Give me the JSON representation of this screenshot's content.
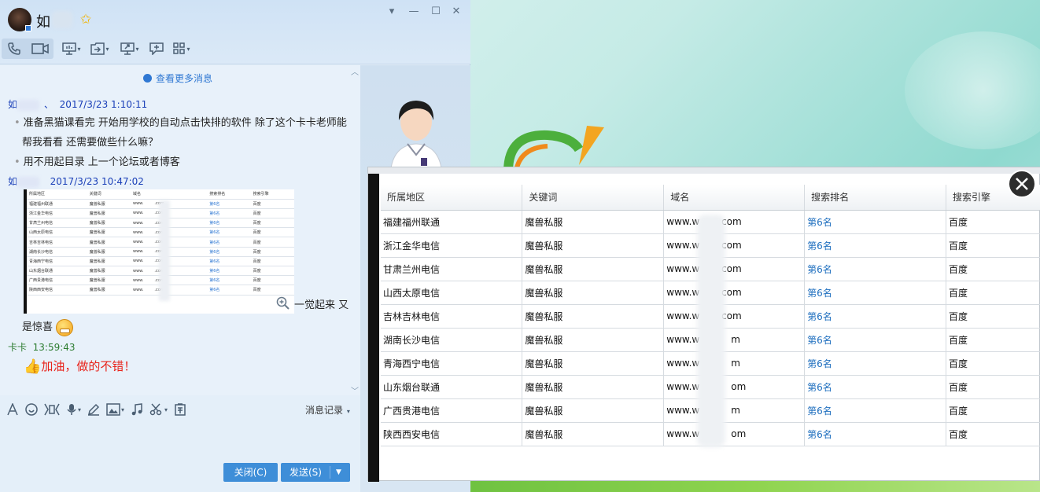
{
  "chat": {
    "contact_name": "如",
    "header": {
      "window_controls": [
        "▾",
        "—",
        "☐",
        "✕"
      ]
    },
    "see_more": "查看更多消息",
    "messages": [
      {
        "sender": "如",
        "sep": "、",
        "time": "2017/3/23 1:10:11"
      },
      {
        "line1": "准备黑猫课看完 开始用学校的自动点击快排的软件 除了这个卡卡老师能",
        "line2": "帮我看看 还需要做些什么嘛？",
        "line3": "用不用起目录 上一个论坛或者博客"
      },
      {
        "sender": "如",
        "time": "2017/3/23 10:47:02",
        "after_image": "一觉起来 又",
        "after_image2": "是惊喜"
      },
      {
        "sender": "卡卡",
        "time": "13:59:43",
        "text": "加油，做的不错！"
      }
    ],
    "history_label": "消息记录",
    "close_label": "关闭(C)",
    "send_label": "发送(S)"
  },
  "thumb_table": {
    "headers": [
      "所属地区",
      "关键词",
      "域名",
      "搜索排名",
      "搜索引擎"
    ],
    "rows": [
      [
        "福建福州联通",
        "魔兽私服",
        "www.",
        ".com",
        "第6名",
        "百度"
      ],
      [
        "浙江金华电信",
        "魔兽私服",
        "www.",
        ".com",
        "第6名",
        "百度"
      ],
      [
        "甘肃兰州电信",
        "魔兽私服",
        "www.",
        ".com",
        "第6名",
        "百度"
      ],
      [
        "山西太原电信",
        "魔兽私服",
        "www.",
        ".com",
        "第6名",
        "百度"
      ],
      [
        "吉林吉林电信",
        "魔兽私服",
        "www.",
        ".com",
        "第6名",
        "百度"
      ],
      [
        "湖南长沙电信",
        "魔兽私服",
        "www.",
        ".com",
        "第6名",
        "百度"
      ],
      [
        "青海西宁电信",
        "魔兽私服",
        "www.",
        ".com",
        "第6名",
        "百度"
      ],
      [
        "山东烟台联通",
        "魔兽私服",
        "www.",
        ".com",
        "第6名",
        "百度"
      ],
      [
        "广西贵港电信",
        "魔兽私服",
        "www.",
        ".com",
        "第6名",
        "百度"
      ],
      [
        "陕西西安电信",
        "魔兽私服",
        "www.",
        ".com",
        "第6名",
        "百度"
      ]
    ]
  },
  "table": {
    "headers": [
      "所属地区",
      "关键词",
      "域名",
      "搜索排名",
      "搜索引擎"
    ],
    "rows": [
      {
        "region": "福建福州联通",
        "keyword": "魔兽私服",
        "domain": "www.w",
        "domain_end": ".com",
        "rank": "第6名",
        "engine": "百度"
      },
      {
        "region": "浙江金华电信",
        "keyword": "魔兽私服",
        "domain": "www.w",
        "domain_end": ".com",
        "rank": "第6名",
        "engine": "百度"
      },
      {
        "region": "甘肃兰州电信",
        "keyword": "魔兽私服",
        "domain": "www.w",
        "domain_end": ".com",
        "rank": "第6名",
        "engine": "百度"
      },
      {
        "region": "山西太原电信",
        "keyword": "魔兽私服",
        "domain": "www.w",
        "domain_end": ".com",
        "rank": "第6名",
        "engine": "百度"
      },
      {
        "region": "吉林吉林电信",
        "keyword": "魔兽私服",
        "domain": "www.w",
        "domain_end": ".com",
        "rank": "第6名",
        "engine": "百度"
      },
      {
        "region": "湖南长沙电信",
        "keyword": "魔兽私服",
        "domain": "www.w",
        "domain_end": "m",
        "rank": "第6名",
        "engine": "百度"
      },
      {
        "region": "青海西宁电信",
        "keyword": "魔兽私服",
        "domain": "www.w",
        "domain_end": "m",
        "rank": "第6名",
        "engine": "百度"
      },
      {
        "region": "山东烟台联通",
        "keyword": "魔兽私服",
        "domain": "www.w",
        "domain_end": "om",
        "rank": "第6名",
        "engine": "百度"
      },
      {
        "region": "广西贵港电信",
        "keyword": "魔兽私服",
        "domain": "www.w",
        "domain_end": "m",
        "rank": "第6名",
        "engine": "百度"
      },
      {
        "region": "陕西西安电信",
        "keyword": "魔兽私服",
        "domain": "www.w",
        "domain_end": "om",
        "rank": "第6名",
        "engine": "百度"
      }
    ]
  },
  "colors": {
    "accent": "#3e8ed8",
    "link": "#2f78d3",
    "rank": "#1f6fbf",
    "highlight": "#e8231a"
  },
  "icons": [
    "phone-icon",
    "video-icon",
    "screen-share-icon",
    "file-transfer-icon",
    "remote-desktop-icon",
    "comment-icon",
    "apps-icon",
    "font-icon",
    "emoji-icon",
    "magic-icon",
    "mic-icon",
    "pen-icon",
    "image-icon",
    "music-icon",
    "scissors-icon",
    "clipboard-icon",
    "zoom-icon",
    "star-icon",
    "close-icon"
  ]
}
